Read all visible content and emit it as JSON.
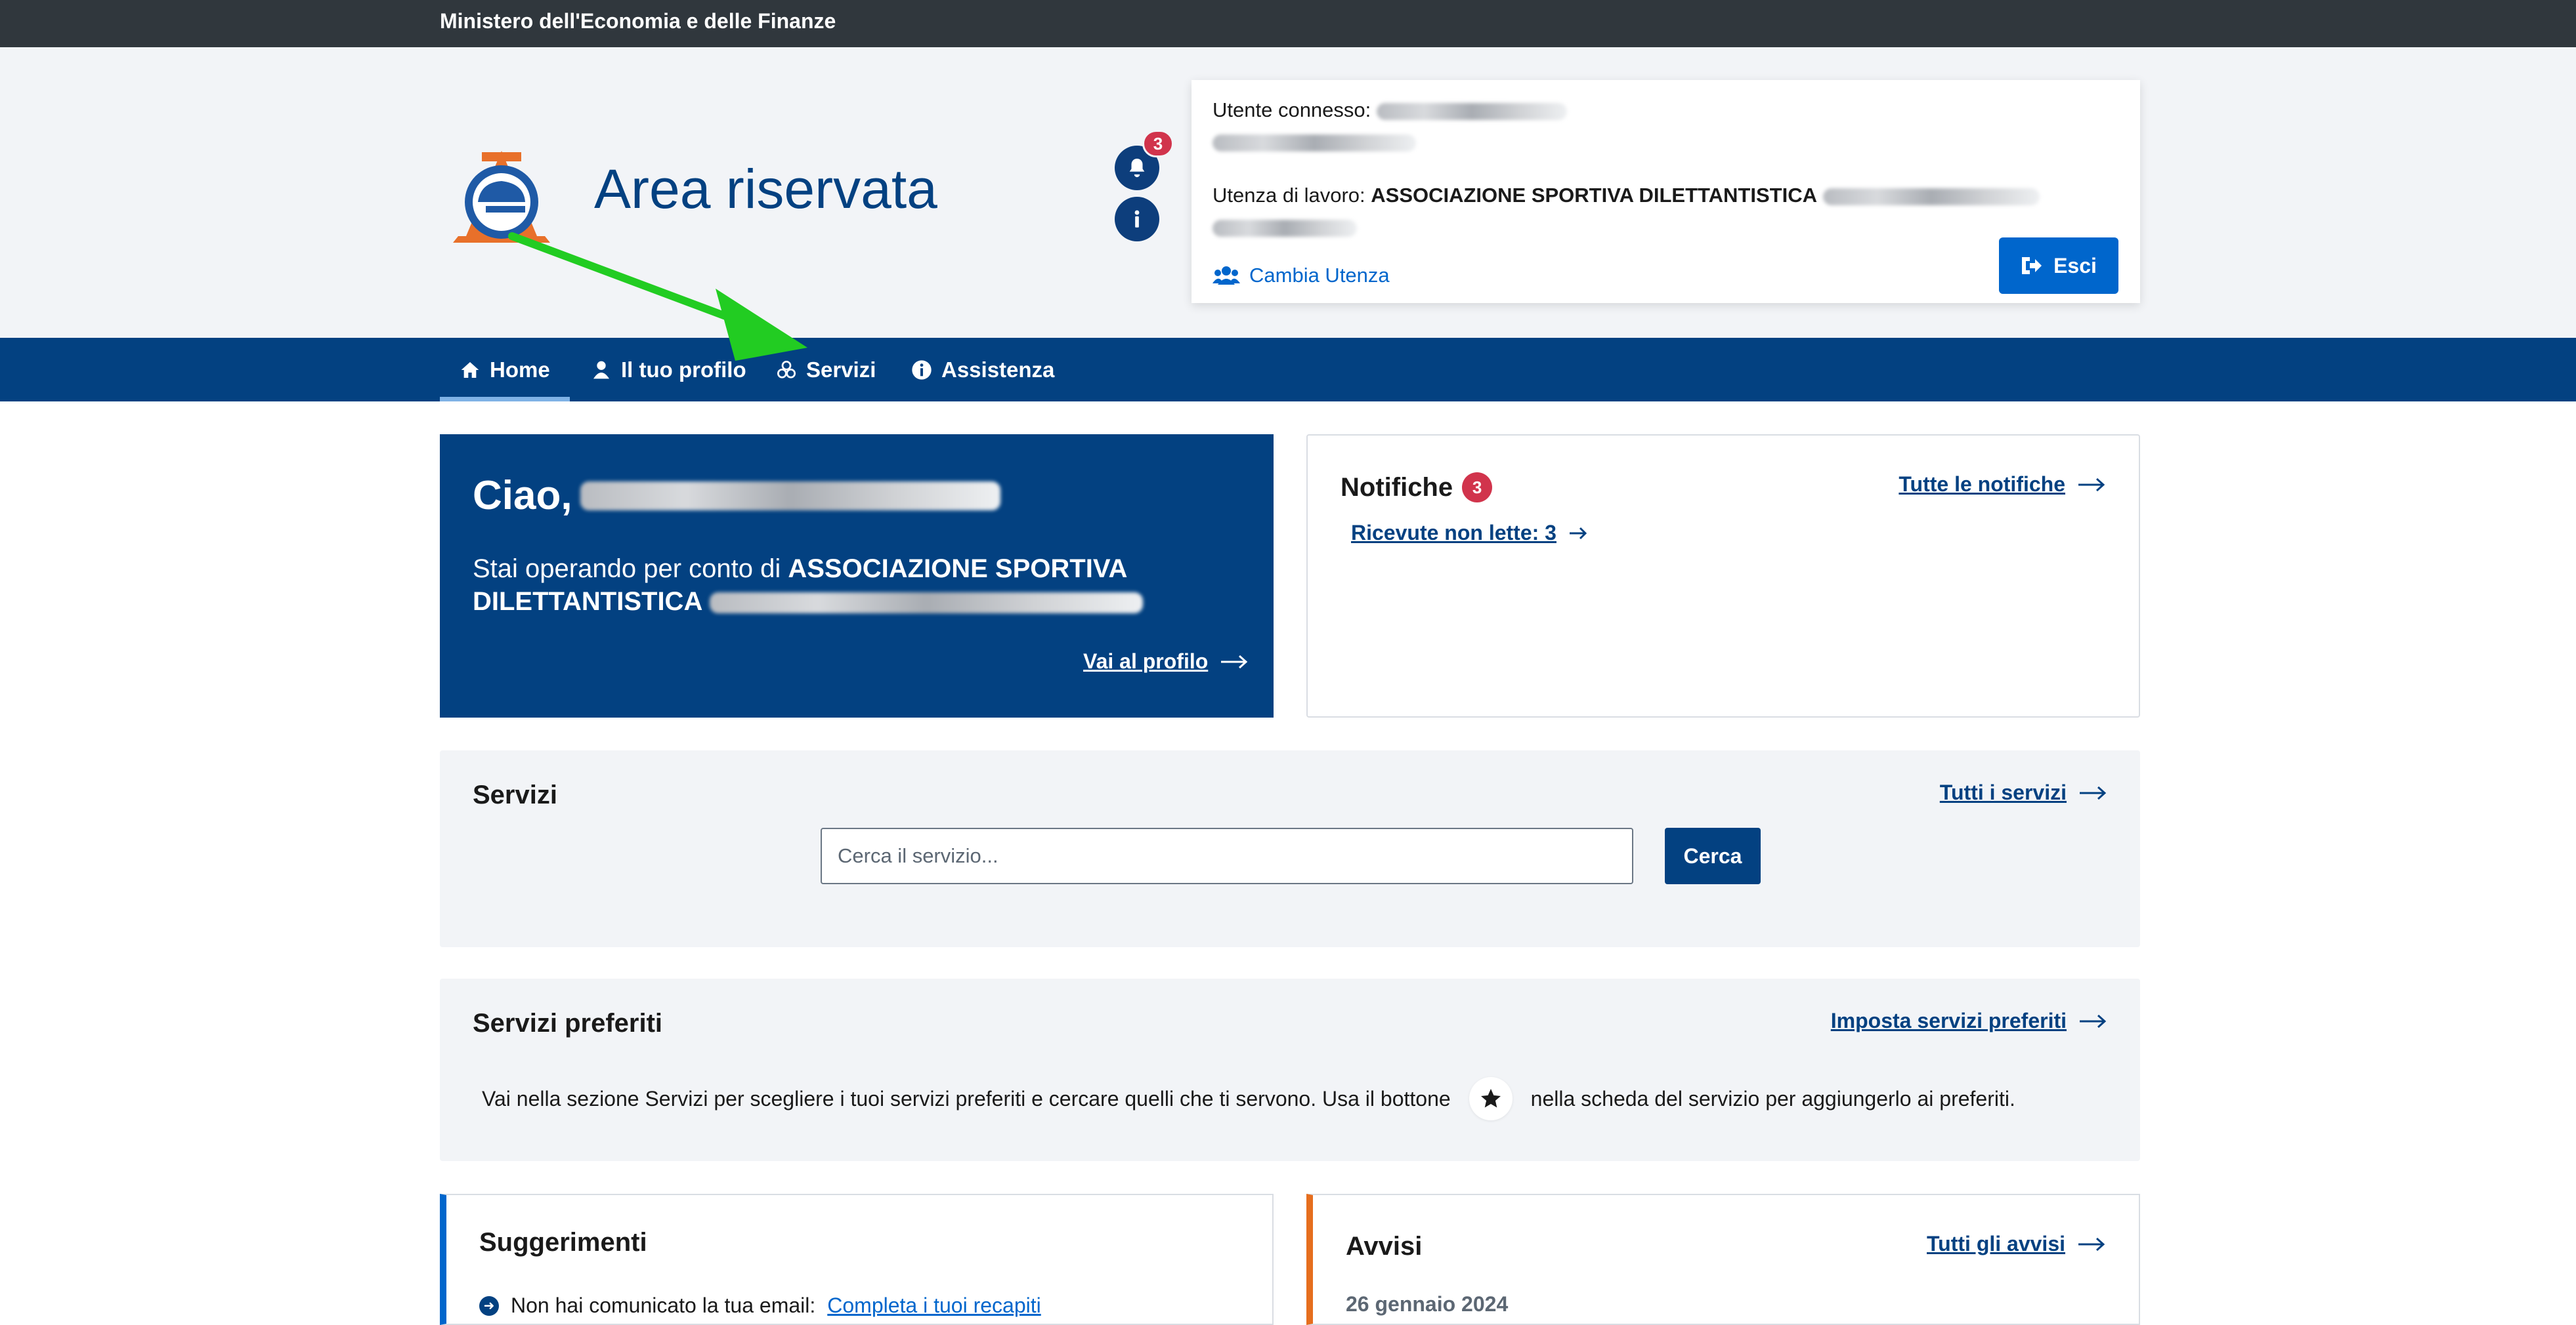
{
  "topbar": {
    "ministry": "Ministero dell'Economia e delle Finanze"
  },
  "header": {
    "title": "Area riservata",
    "notification_count": "3",
    "user": {
      "connected_label": "Utente connesso:",
      "workplace_label": "Utenza di lavoro:",
      "workplace_name": "ASSOCIAZIONE SPORTIVA DILETTANTISTICA",
      "switch_label": "Cambia Utenza",
      "logout_label": "Esci"
    }
  },
  "nav": {
    "items": [
      {
        "label": "Home",
        "icon": "home-icon",
        "active": true
      },
      {
        "label": "Il tuo profilo",
        "icon": "user-icon"
      },
      {
        "label": "Servizi",
        "icon": "services-icon"
      },
      {
        "label": "Assistenza",
        "icon": "info-icon"
      }
    ]
  },
  "welcome": {
    "greeting": "Ciao,",
    "acting_prefix": "Stai operando per conto di",
    "acting_entity": "ASSOCIAZIONE SPORTIVA DILETTANTISTICA",
    "profile_link": "Vai al profilo"
  },
  "notifications": {
    "title": "Notifiche",
    "count": "3",
    "all_link": "Tutte le notifiche",
    "unread_link": "Ricevute non lette: 3"
  },
  "services": {
    "title": "Servizi",
    "all_link": "Tutti i servizi",
    "search_placeholder": "Cerca il servizio...",
    "search_button": "Cerca"
  },
  "favorites": {
    "title": "Servizi preferiti",
    "set_link": "Imposta servizi preferiti",
    "desc_before": "Vai nella sezione Servizi per scegliere i tuoi servizi preferiti e cercare quelli che ti servono. Usa il bottone",
    "desc_after": "nella scheda del servizio per aggiungerlo ai preferiti."
  },
  "suggestions": {
    "title": "Suggerimenti",
    "tip_text": "Non hai comunicato la tua email:",
    "tip_link": "Completa i tuoi recapiti"
  },
  "notices": {
    "title": "Avvisi",
    "all_link": "Tutti gli avvisi",
    "date": "26 gennaio 2024"
  },
  "colors": {
    "primary": "#034181",
    "accent_blue": "#0066cc",
    "badge_red": "#d1344c",
    "topbar": "#30373d",
    "header_bg": "#f2f4f7",
    "annotation_arrow": "#22cc22"
  }
}
